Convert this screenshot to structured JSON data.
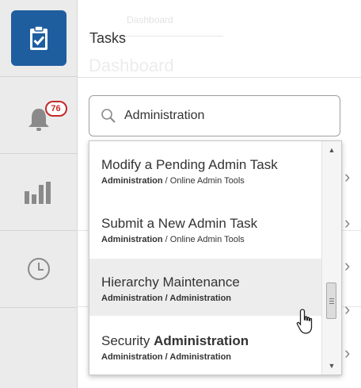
{
  "header": {
    "title": "Tasks",
    "ghost_tab": "Dashboard",
    "ghost_title": "Dashboard"
  },
  "notifications": {
    "count": "76"
  },
  "search": {
    "value": "Administration"
  },
  "dropdown": {
    "options": [
      {
        "main": "Modify a Pending Admin Task",
        "bold": "",
        "path_strong": "Administration",
        "path_sep": " / ",
        "path_rest": "Online Admin Tools",
        "rest_bold": false
      },
      {
        "main": "Submit a New Admin Task",
        "bold": "",
        "path_strong": "Administration",
        "path_sep": " / ",
        "path_rest": "Online Admin Tools",
        "rest_bold": false
      },
      {
        "main": "Hierarchy Maintenance",
        "bold": "",
        "path_strong": "Administration",
        "path_sep": " / ",
        "path_rest": "Administration",
        "rest_bold": true
      },
      {
        "main": "Security ",
        "bold": "Administration",
        "path_strong": "Administration",
        "path_sep": " / ",
        "path_rest": "Administration",
        "rest_bold": true
      }
    ]
  },
  "colors": {
    "accent": "#1f5e9e",
    "badge": "#c62828"
  },
  "icons": [
    "clipboard-check-icon",
    "bell-icon",
    "bar-chart-icon",
    "clock-icon",
    "search-icon",
    "chevron-right-icon",
    "hand-cursor-icon"
  ]
}
